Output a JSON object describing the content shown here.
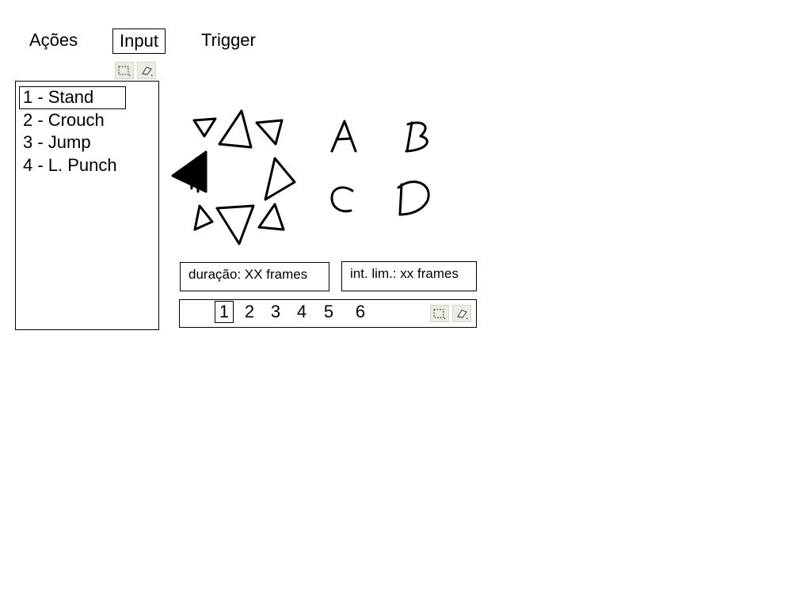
{
  "tabs": [
    {
      "label": "Ações",
      "selected": false
    },
    {
      "label": "Input",
      "selected": true
    },
    {
      "label": "Trigger",
      "selected": false
    }
  ],
  "toolbar_top": {
    "icons": [
      "select-icon",
      "eraser-icon"
    ]
  },
  "actions": {
    "items": [
      {
        "label": "1 - Stand",
        "selected": true
      },
      {
        "label": "2 - Crouch",
        "selected": false
      },
      {
        "label": "3 - Jump",
        "selected": false
      },
      {
        "label": "4 - L. Punch",
        "selected": false
      }
    ]
  },
  "input_pad": {
    "directions": [
      "up-left",
      "up",
      "up-right",
      "left",
      "right",
      "down-left",
      "down",
      "down-right"
    ],
    "active_direction": "left",
    "buttons": [
      "A",
      "B",
      "C",
      "D"
    ]
  },
  "fields": {
    "duration": "duração: XX frames",
    "interval_limit": "int. lim.: xx frames"
  },
  "frames": {
    "items": [
      "1",
      "2",
      "3",
      "4",
      "5",
      "6"
    ],
    "selected": "1",
    "icons": [
      "select-icon",
      "eraser-icon"
    ]
  }
}
